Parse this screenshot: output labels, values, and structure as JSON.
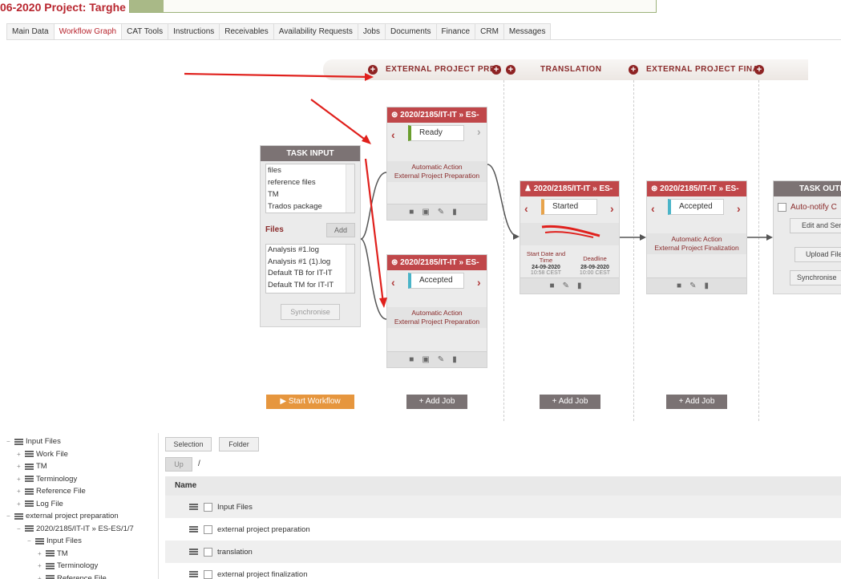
{
  "title": "06-2020 Project: Targhe",
  "tabs": [
    "Main Data",
    "Workflow Graph",
    "CAT Tools",
    "Instructions",
    "Receivables",
    "Availability Requests",
    "Jobs",
    "Documents",
    "Finance",
    "CRM",
    "Messages"
  ],
  "active_tab": "Workflow Graph",
  "phases": [
    "EXTERNAL PROJECT PREP",
    "TRANSLATION",
    "EXTERNAL PROJECT FINA"
  ],
  "task_input": {
    "header": "TASK INPUT",
    "types": [
      "files",
      "reference files",
      "TM",
      "Trados package"
    ],
    "files_label": "Files",
    "add_label": "Add",
    "files": [
      "Analysis #1.log",
      "Analysis #1 (1).log",
      "Default TB for IT-IT",
      "Default TM for IT-IT"
    ],
    "sync_label": "Synchronise"
  },
  "jobs": [
    {
      "title": "2020/2185/IT-IT » ES-",
      "status": "Ready",
      "action_line1": "Automatic Action",
      "action_line2": "External Project Preparation"
    },
    {
      "title": "2020/2185/IT-IT » ES-",
      "status": "Accepted",
      "action_line1": "Automatic Action",
      "action_line2": "External Project Preparation"
    },
    {
      "title": "2020/2185/IT-IT » ES-",
      "status": "Started",
      "start_label": "Start Date and Time",
      "start_date": "24-09-2020",
      "start_time": "10:58 CEST",
      "deadline_label": "Deadline",
      "deadline_date": "28-09-2020",
      "deadline_time": "10:00 CEST"
    },
    {
      "title": "2020/2185/IT-IT » ES-",
      "status": "Accepted",
      "action_line1": "Automatic Action",
      "action_line2": "External Project Finalization"
    }
  ],
  "task_output": {
    "header": "TASK OUTPU",
    "auto_notify": "Auto-notify C",
    "edit_send": "Edit and Sen",
    "upload": "Upload File",
    "sync": "Synchronise"
  },
  "buttons": {
    "start_workflow": "Start Workflow",
    "add_job": "Add Job"
  },
  "tree": [
    {
      "level": 0,
      "toggle": "−",
      "label": "Input Files"
    },
    {
      "level": 1,
      "toggle": "+",
      "label": "Work File"
    },
    {
      "level": 1,
      "toggle": "+",
      "label": "TM"
    },
    {
      "level": 1,
      "toggle": "+",
      "label": "Terminology"
    },
    {
      "level": 1,
      "toggle": "+",
      "label": "Reference File"
    },
    {
      "level": 1,
      "toggle": "+",
      "label": "Log File"
    },
    {
      "level": 0,
      "toggle": "−",
      "label": "external project preparation"
    },
    {
      "level": 1,
      "toggle": "−",
      "label": "2020/2185/IT-IT » ES-ES/1/7"
    },
    {
      "level": 2,
      "toggle": "−",
      "label": "Input Files"
    },
    {
      "level": 3,
      "toggle": "+",
      "label": "TM"
    },
    {
      "level": 3,
      "toggle": "+",
      "label": "Terminology"
    },
    {
      "level": 3,
      "toggle": "+",
      "label": "Reference File"
    }
  ],
  "file_browser": {
    "selection": "Selection",
    "folder": "Folder",
    "up": "Up",
    "path": "/",
    "name_header": "Name",
    "rows": [
      "Input Files",
      "external project preparation",
      "translation",
      "external project finalization"
    ]
  },
  "colors": {
    "brand_red": "#b8262f",
    "job_header": "#c0474a",
    "ready": "#6a9e2e",
    "accepted": "#4ab4c8",
    "started": "#e7a34b",
    "start_button": "#e6963e",
    "annotation_arrow": "#e0201c"
  }
}
